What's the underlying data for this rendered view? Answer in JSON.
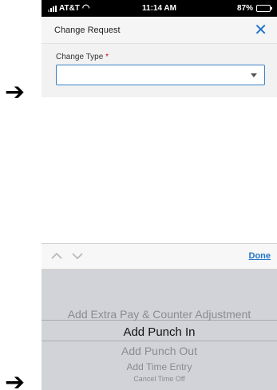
{
  "status_bar": {
    "carrier": "AT&T",
    "wifi_icon": "wifi-icon",
    "time": "11:14 AM",
    "battery": "87%",
    "battery_level": 0.87
  },
  "dialog": {
    "title": "Change Request",
    "close_icon": "close-icon"
  },
  "form": {
    "change_type_label": "Change Type",
    "required_marker": "*",
    "change_type_value": ""
  },
  "picker": {
    "done_label": "Done",
    "options": [
      "Add Extra Pay & Counter Adjustment",
      "Add Punch In",
      "Add Punch Out",
      "Add Time Entry",
      "Cancel Time Off"
    ],
    "selected_index": 1
  },
  "annotations": {
    "arrow_glyph": "➔"
  },
  "colors": {
    "accent": "#1f74c7",
    "required": "#d0021b",
    "picker_bg": "#d1d3d8"
  }
}
